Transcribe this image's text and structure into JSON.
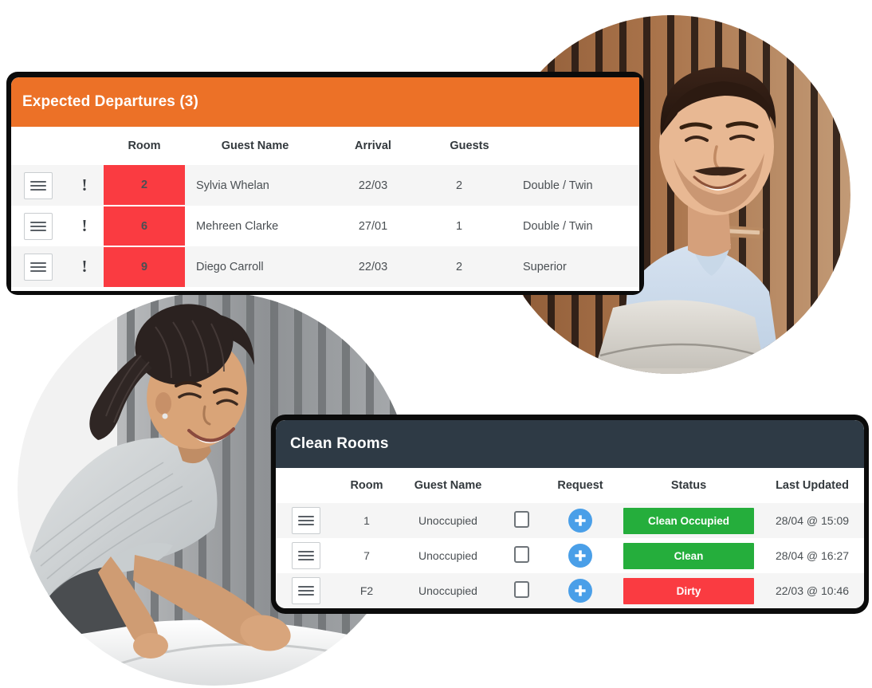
{
  "departures": {
    "title": "Expected Departures (3)",
    "accent_color": "#ec7127",
    "room_cell_color": "#fa3b41",
    "columns": {
      "menu": "",
      "alert": "",
      "room": "Room",
      "guest_name": "Guest Name",
      "arrival": "Arrival",
      "guests": "Guests",
      "room_type": ""
    },
    "rows": [
      {
        "menu_icon": "hamburger-icon",
        "alert": "!",
        "room": "2",
        "guest_name": "Sylvia Whelan",
        "arrival": "22/03",
        "guests": "2",
        "room_type": "Double / Twin"
      },
      {
        "menu_icon": "hamburger-icon",
        "alert": "!",
        "room": "6",
        "guest_name": "Mehreen Clarke",
        "arrival": "27/01",
        "guests": "1",
        "room_type": "Double / Twin"
      },
      {
        "menu_icon": "hamburger-icon",
        "alert": "!",
        "room": "9",
        "guest_name": "Diego Carroll",
        "arrival": "22/03",
        "guests": "2",
        "room_type": "Superior"
      }
    ]
  },
  "clean_rooms": {
    "title": "Clean Rooms",
    "header_color": "#2e3a45",
    "clean_color": "#25ae3c",
    "dirty_color": "#fa3b41",
    "request_color": "#4a9fe8",
    "columns": {
      "menu": "",
      "room": "Room",
      "guest_name": "Guest Name",
      "checkbox": "",
      "request": "Request",
      "status": "Status",
      "last_updated": "Last Updated"
    },
    "rows": [
      {
        "menu_icon": "hamburger-icon",
        "room": "1",
        "guest_name": "Unoccupied",
        "checkbox": false,
        "request_icon": "plus-circle-icon",
        "status": "Clean Occupied",
        "status_kind": "clean",
        "last_updated": "28/04 @ 15:09"
      },
      {
        "menu_icon": "hamburger-icon",
        "room": "7",
        "guest_name": "Unoccupied",
        "checkbox": false,
        "request_icon": "plus-circle-icon",
        "status": "Clean",
        "status_kind": "clean",
        "last_updated": "28/04 @ 16:27"
      },
      {
        "menu_icon": "hamburger-icon",
        "room": "F2",
        "guest_name": "Unoccupied",
        "checkbox": false,
        "request_icon": "plus-circle-icon",
        "status": "Dirty",
        "status_kind": "dirty",
        "last_updated": "22/03 @ 10:46"
      }
    ]
  },
  "photos": [
    {
      "name": "receptionist-at-laptop-photo",
      "description": "Smiling hotel receptionist in light blue shirt working at a laptop in front of a wooden slat wall"
    },
    {
      "name": "housekeeper-making-bed-photo",
      "description": "Smiling housekeeper in grey uniform making a bed with white linen beside grey curtains"
    }
  ]
}
